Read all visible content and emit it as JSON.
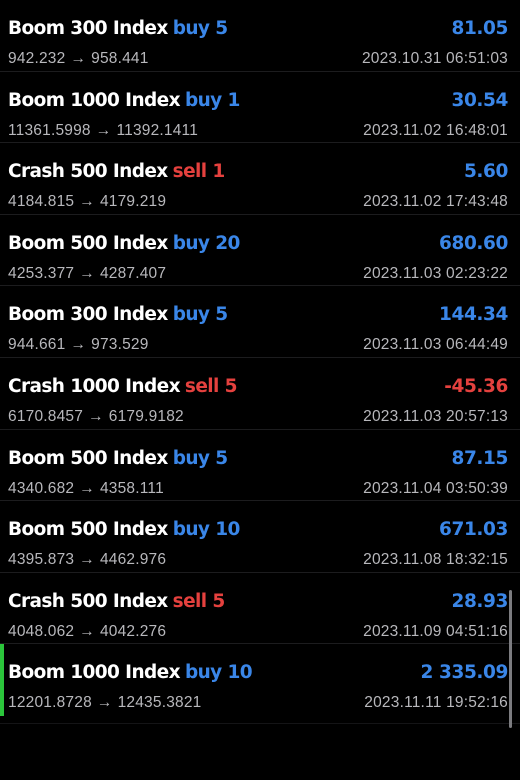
{
  "colors": {
    "background": "#000000",
    "buy": "#3a86e8",
    "sell": "#e5413e",
    "profit_positive": "#3a86e8",
    "profit_negative": "#e5413e",
    "secondary_text": "#b8b8bc",
    "selected_indicator": "#2bc53b"
  },
  "icons": {
    "arrow": "→"
  },
  "deals": [
    {
      "symbol": "Boom 300 Index",
      "direction": "buy",
      "direction_label": "buy 5",
      "profit": "81.05",
      "open_price": "942.232",
      "close_price": "958.441",
      "time": "2023.10.31 06:51:03",
      "selected": false
    },
    {
      "symbol": "Boom 1000 Index",
      "direction": "buy",
      "direction_label": "buy 1",
      "profit": "30.54",
      "open_price": "11361.5998",
      "close_price": "11392.1411",
      "time": "2023.11.02 16:48:01",
      "selected": false
    },
    {
      "symbol": "Crash 500 Index",
      "direction": "sell",
      "direction_label": "sell 1",
      "profit": "5.60",
      "open_price": "4184.815",
      "close_price": "4179.219",
      "time": "2023.11.02 17:43:48",
      "selected": false
    },
    {
      "symbol": "Boom 500 Index",
      "direction": "buy",
      "direction_label": "buy 20",
      "profit": "680.60",
      "open_price": "4253.377",
      "close_price": "4287.407",
      "time": "2023.11.03 02:23:22",
      "selected": false
    },
    {
      "symbol": "Boom 300 Index",
      "direction": "buy",
      "direction_label": "buy 5",
      "profit": "144.34",
      "open_price": "944.661",
      "close_price": "973.529",
      "time": "2023.11.03 06:44:49",
      "selected": false
    },
    {
      "symbol": "Crash 1000 Index",
      "direction": "sell",
      "direction_label": "sell 5",
      "profit": "-45.36",
      "open_price": "6170.8457",
      "close_price": "6179.9182",
      "time": "2023.11.03 20:57:13",
      "selected": false
    },
    {
      "symbol": "Boom 500 Index",
      "direction": "buy",
      "direction_label": "buy 5",
      "profit": "87.15",
      "open_price": "4340.682",
      "close_price": "4358.111",
      "time": "2023.11.04 03:50:39",
      "selected": false
    },
    {
      "symbol": "Boom 500 Index",
      "direction": "buy",
      "direction_label": "buy 10",
      "profit": "671.03",
      "open_price": "4395.873",
      "close_price": "4462.976",
      "time": "2023.11.08 18:32:15",
      "selected": false
    },
    {
      "symbol": "Crash 500 Index",
      "direction": "sell",
      "direction_label": "sell 5",
      "profit": "28.93",
      "open_price": "4048.062",
      "close_price": "4042.276",
      "time": "2023.11.09 04:51:16",
      "selected": false
    },
    {
      "symbol": "Boom 1000 Index",
      "direction": "buy",
      "direction_label": "buy 10",
      "profit": "2 335.09",
      "open_price": "12201.8728",
      "close_price": "12435.3821",
      "time": "2023.11.11 19:52:16",
      "selected": true
    }
  ]
}
